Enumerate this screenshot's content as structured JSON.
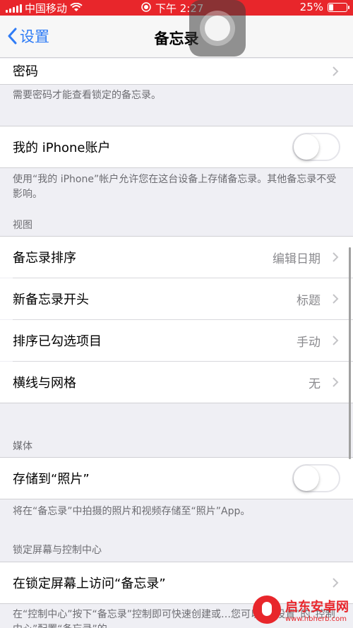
{
  "status_bar": {
    "carrier": "中国移动",
    "time": "下午 2:27",
    "battery": "25%",
    "battery_level": 0.25,
    "color": "#e8262b"
  },
  "nav": {
    "back_label": "设置",
    "title": "备忘录",
    "accent": "#2f7cf6"
  },
  "password": {
    "label": "密码",
    "note": "需要密码才能查看锁定的备忘录。"
  },
  "iphone_account": {
    "label": "我的 iPhone账户",
    "enabled": false,
    "note": "使用“我的 iPhone”帐户允许您在这台设备上存储备忘录。其他备忘录不受影响。"
  },
  "view_section": {
    "header": "视图",
    "items": [
      {
        "label": "备忘录排序",
        "value": "编辑日期"
      },
      {
        "label": "新备忘录开头",
        "value": "标题"
      },
      {
        "label": "排序已勾选项目",
        "value": "手动"
      },
      {
        "label": "横线与网格",
        "value": "无"
      }
    ]
  },
  "media_section": {
    "header": "媒体",
    "save_label": "存储到“照片”",
    "enabled": false,
    "note": "将在“备忘录”中拍摄的照片和视频存储至“照片”App。"
  },
  "lock_section": {
    "header": "锁定屏幕与控制中心",
    "access_label": "在锁定屏幕上访问“备忘录”",
    "note": "在“控制中心”按下“备忘录”控制即可快速创建或…您可以在“设置”的“控制中心”配置“备忘录”的…"
  },
  "watermark": {
    "name": "启东安卓网",
    "url": "www.hbherb.com"
  }
}
